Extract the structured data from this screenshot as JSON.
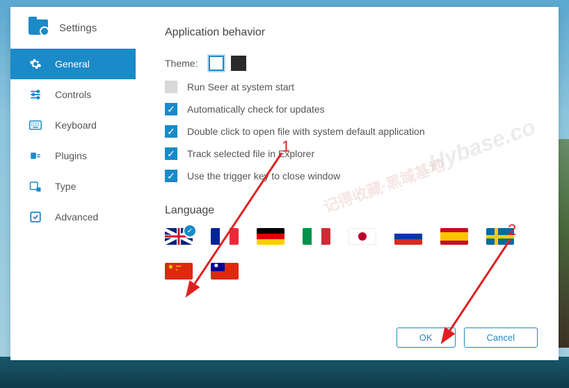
{
  "sidebar": {
    "title": "Settings",
    "items": [
      {
        "label": "General"
      },
      {
        "label": "Controls"
      },
      {
        "label": "Keyboard"
      },
      {
        "label": "Plugins"
      },
      {
        "label": "Type"
      },
      {
        "label": "Advanced"
      }
    ]
  },
  "content": {
    "section_title": "Application behavior",
    "theme_label": "Theme:",
    "checkboxes": [
      {
        "label": "Run Seer at system start",
        "checked": false
      },
      {
        "label": "Automatically check for updates",
        "checked": true
      },
      {
        "label": "Double click to open file with system default application",
        "checked": true
      },
      {
        "label": "Track selected file in Explorer",
        "checked": true
      },
      {
        "label": "Use the trigger key to close window",
        "checked": true
      }
    ],
    "language_label": "Language",
    "flags": [
      "uk",
      "fr",
      "de",
      "it",
      "jp",
      "ru",
      "es",
      "se",
      "cn",
      "tw"
    ],
    "selected_flag": "uk"
  },
  "buttons": {
    "ok": "OK",
    "cancel": "Cancel"
  },
  "watermarks": {
    "w1": "Hybase.co",
    "w2": "记得收藏·黑域基地"
  },
  "annotations": {
    "a1": "1",
    "a2": "2"
  }
}
